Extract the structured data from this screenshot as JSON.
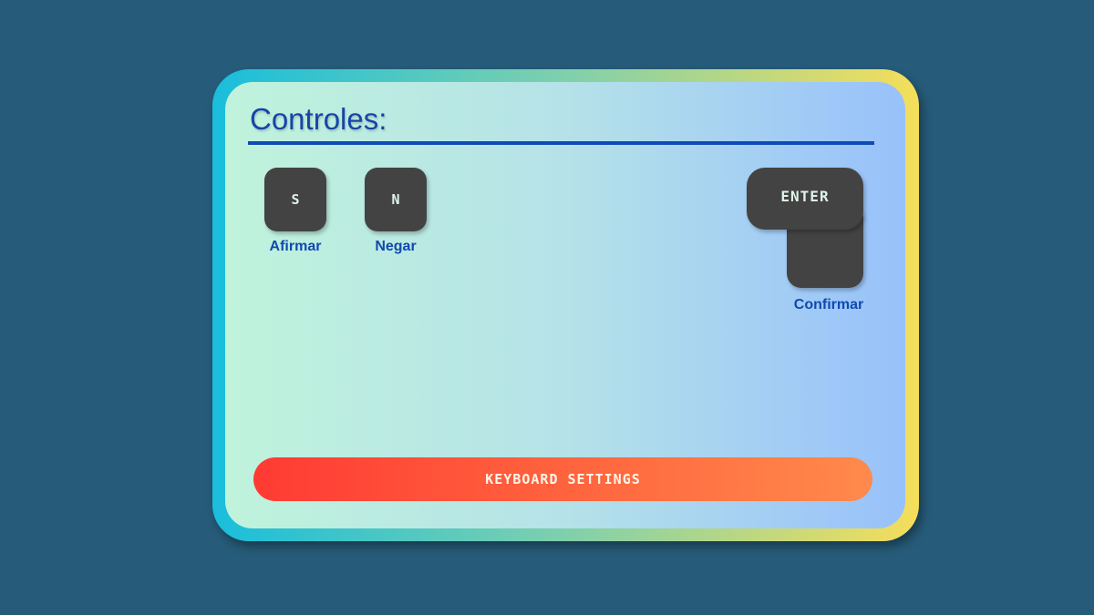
{
  "panel": {
    "title": "Controles:"
  },
  "keys": [
    {
      "key": "S",
      "caption": "Afirmar"
    },
    {
      "key": "N",
      "caption": "Negar"
    },
    {
      "key": "ENTER",
      "caption": "Confirmar"
    }
  ],
  "settings_button": {
    "label": "KEYBOARD SETTINGS"
  },
  "colors": {
    "page_background": "#265b79",
    "title_blue": "#1744a8",
    "key_fill": "#434343",
    "button_red": "#ff3a33",
    "button_orange": "#ff8a4c"
  }
}
